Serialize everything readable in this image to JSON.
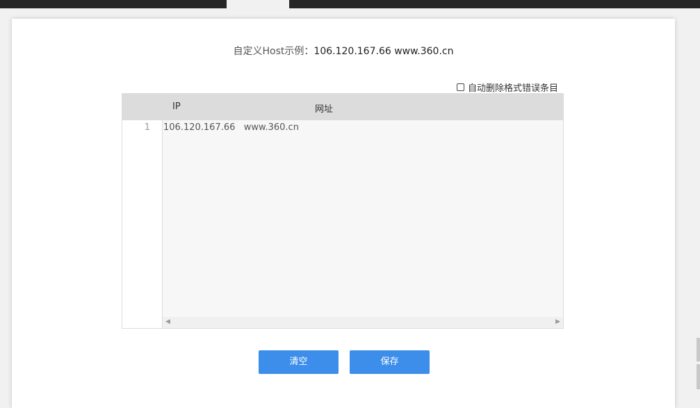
{
  "example": {
    "label": "自定义Host示例：",
    "value": "106.120.167.66   www.360.cn"
  },
  "auto_delete": {
    "label": "自动删除格式错误条目",
    "checked": false
  },
  "editor": {
    "columns": [
      "IP",
      "网址"
    ],
    "lines": [
      {
        "number": "1",
        "text": "106.120.167.66   www.360.cn"
      }
    ]
  },
  "buttons": {
    "clear_label": "清空",
    "save_label": "保存"
  },
  "colors": {
    "button_bg": "#3d8eea",
    "header_bg": "#dcdcdc"
  }
}
